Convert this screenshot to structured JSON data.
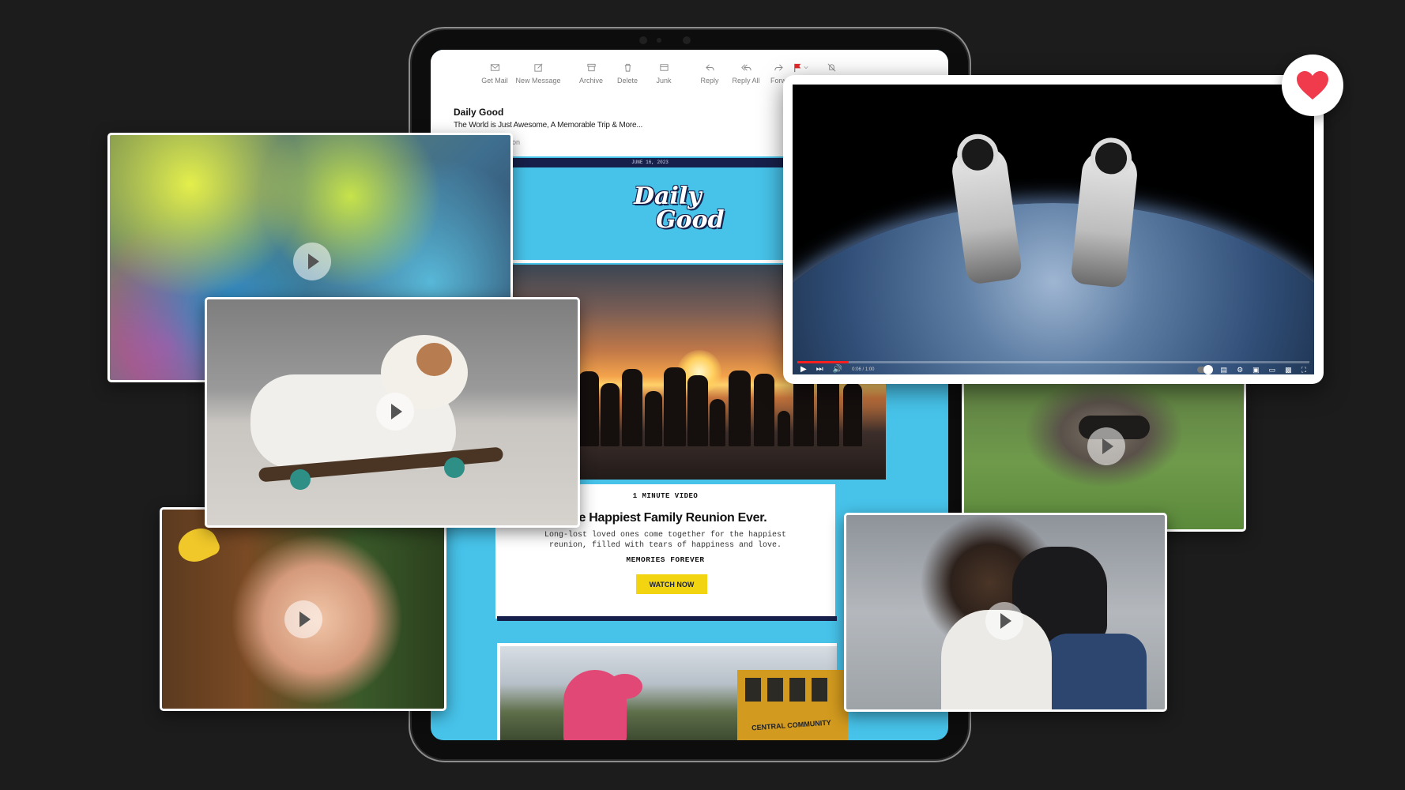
{
  "mail": {
    "toolbar": [
      {
        "label": "Get Mail",
        "icon": "envelope-icon"
      },
      {
        "label": "New Message",
        "icon": "compose-icon"
      },
      {
        "label": "Archive",
        "icon": "archive-icon"
      },
      {
        "label": "Delete",
        "icon": "trash-icon"
      },
      {
        "label": "Junk",
        "icon": "junk-icon"
      },
      {
        "label": "Reply",
        "icon": "reply-icon"
      },
      {
        "label": "Reply All",
        "icon": "reply-all-icon"
      },
      {
        "label": "Forw",
        "icon": "forward-icon"
      }
    ],
    "sender": "Daily Good",
    "subject": "The World is Just Awesome, A Memorable Trip & More...",
    "to_snippet": "on"
  },
  "newsletter": {
    "date": "JUNE 16, 2023",
    "logo_line1": "Daily",
    "logo_line2": "Good",
    "kicker": "1 MINUTE VIDEO",
    "headline": "The Happiest Family Reunion Ever.",
    "description": "Long-lost loved ones come together for the happiest reunion, filled with tears of happiness and love.",
    "tagline": "MEMORIES FOREVER",
    "cta_label": "WATCH NOW",
    "bus_text": "CENTRAL COMMUNITY"
  },
  "player": {
    "time": "0:06 / 1:00",
    "progress": 0.1,
    "accent_color": "#ff1f1f"
  },
  "colors": {
    "newsletter_blue": "#47c3ea",
    "navy": "#17204a",
    "cta_yellow": "#f3d410",
    "heart_red": "#ef3b4b"
  }
}
